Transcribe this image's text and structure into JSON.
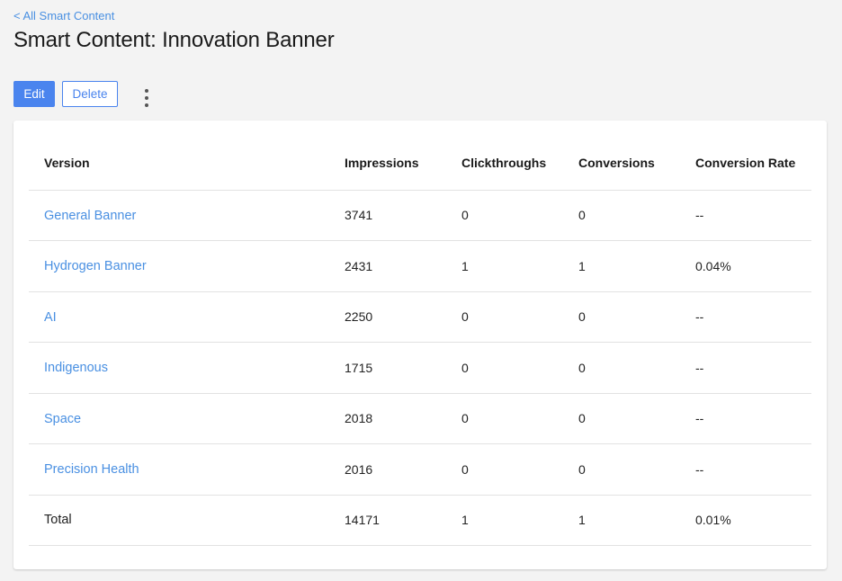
{
  "breadcrumb": {
    "back_label": "< All Smart Content"
  },
  "page": {
    "title": "Smart Content: Innovation Banner"
  },
  "toolbar": {
    "edit_label": "Edit",
    "delete_label": "Delete"
  },
  "colors": {
    "accent": "#4a84ee",
    "link": "#4a90e2"
  },
  "table": {
    "headers": {
      "version": "Version",
      "impressions": "Impressions",
      "clickthroughs": "Clickthroughs",
      "conversions": "Conversions",
      "conversion_rate": "Conversion Rate"
    },
    "rows": [
      {
        "version": "General Banner",
        "impressions": "3741",
        "clickthroughs": "0",
        "conversions": "0",
        "conversion_rate": "--"
      },
      {
        "version": "Hydrogen Banner",
        "impressions": "2431",
        "clickthroughs": "1",
        "conversions": "1",
        "conversion_rate": "0.04%"
      },
      {
        "version": "AI",
        "impressions": "2250",
        "clickthroughs": "0",
        "conversions": "0",
        "conversion_rate": "--"
      },
      {
        "version": "Indigenous",
        "impressions": "1715",
        "clickthroughs": "0",
        "conversions": "0",
        "conversion_rate": "--"
      },
      {
        "version": "Space",
        "impressions": "2018",
        "clickthroughs": "0",
        "conversions": "0",
        "conversion_rate": "--"
      },
      {
        "version": "Precision Health",
        "impressions": "2016",
        "clickthroughs": "0",
        "conversions": "0",
        "conversion_rate": "--"
      }
    ],
    "total": {
      "label": "Total",
      "impressions": "14171",
      "clickthroughs": "1",
      "conversions": "1",
      "conversion_rate": "0.01%"
    }
  }
}
